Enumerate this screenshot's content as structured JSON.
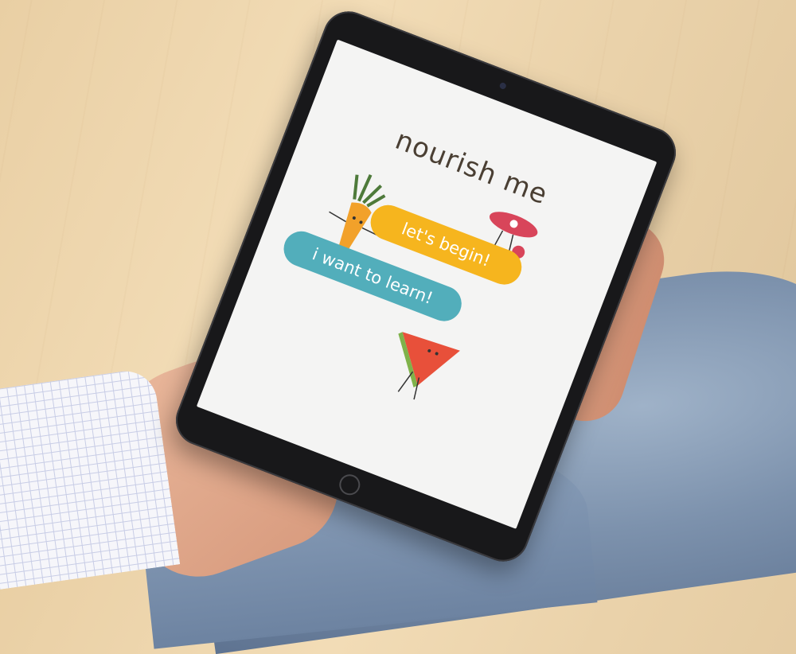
{
  "app": {
    "title": "nourish me"
  },
  "buttons": {
    "begin_label": "let's begin!",
    "learn_label": "i want to learn!"
  },
  "colors": {
    "begin_button": "#f6b51e",
    "learn_button": "#52aebb",
    "screen_bg": "#f4f4f3",
    "title_text": "#4a3f33"
  },
  "illustrations": [
    "carrot-character",
    "watermelon-character",
    "ham-character"
  ]
}
